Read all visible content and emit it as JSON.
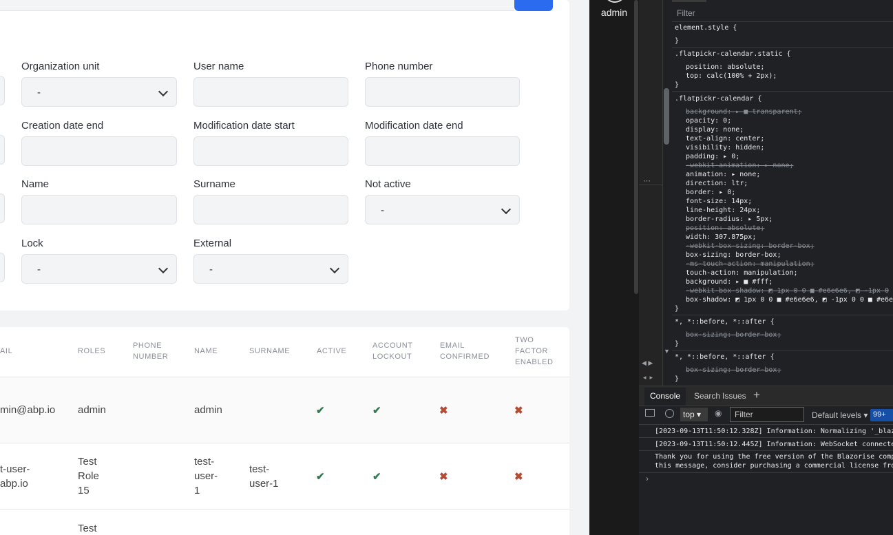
{
  "filters": {
    "org_unit": {
      "label": "Organization unit",
      "value": "-"
    },
    "user_name": {
      "label": "User name",
      "value": ""
    },
    "phone_number": {
      "label": "Phone number",
      "value": ""
    },
    "creation_date_end": {
      "label": "Creation date end",
      "value": ""
    },
    "modification_date_start": {
      "label": "Modification date start",
      "value": ""
    },
    "modification_date_end": {
      "label": "Modification date end",
      "value": ""
    },
    "name": {
      "label": "Name",
      "value": ""
    },
    "surname": {
      "label": "Surname",
      "value": ""
    },
    "not_active": {
      "label": "Not active",
      "value": "-"
    },
    "lock": {
      "label": "Lock",
      "value": "-"
    },
    "external": {
      "label": "External",
      "value": "-"
    }
  },
  "table": {
    "headers": {
      "email": "AIL",
      "roles": "ROLES",
      "phone_number_1": "PHONE",
      "phone_number_2": "NUMBER",
      "name": "NAME",
      "surname": "SURNAME",
      "active": "ACTIVE",
      "account_lockout_1": "ACCOUNT",
      "account_lockout_2": "LOCKOUT",
      "email_confirmed_1": "EMAIL",
      "email_confirmed_2": "CONFIRMED",
      "two_factor_1": "TWO",
      "two_factor_2": "FACTOR",
      "two_factor_3": "ENABLED"
    },
    "rows": [
      {
        "email": "min@abp.io",
        "roles": "admin",
        "name": "admin",
        "surname": ""
      },
      {
        "email_1": "t-user-",
        "email_2": "abp.io",
        "roles_1": "Test",
        "roles_2": "Role",
        "roles_3": "15",
        "name_1": "test-",
        "name_2": "user-",
        "name_3": "1",
        "surname_1": "test-",
        "surname_2": "user-1"
      },
      {
        "roles_1": "Test"
      }
    ],
    "check_icon": "✔",
    "cross_icon": "✖"
  },
  "user_menu": {
    "name": "admin"
  },
  "devtools": {
    "styles_filter": "Filter",
    "rules": [
      {
        "selector": "element.style {",
        "close": "}"
      },
      {
        "selector": ".flatpickr-calendar.static {",
        "props": [
          "position: absolute;",
          "top: calc(100% + 2px);"
        ],
        "close": "}"
      },
      {
        "selector": ".flatpickr-calendar {",
        "close": "}"
      },
      {
        "selector": "*, *::before, *::after {",
        "props": [
          "box-sizing: border-box;"
        ],
        "close": "}"
      },
      {
        "selector": "*, *::before, *::after {",
        "props": [
          "box-sizing: border-box;"
        ],
        "close": "}"
      }
    ],
    "calendar_props": [
      {
        "t": "background: ▸ ■ transparent;",
        "strike": true
      },
      {
        "t": "opacity: 0;"
      },
      {
        "t": "display: none;"
      },
      {
        "t": "text-align: center;"
      },
      {
        "t": "visibility: hidden;"
      },
      {
        "t": "padding: ▸ 0;"
      },
      {
        "t": "-webkit-animation: ▸ none;",
        "strike": true
      },
      {
        "t": "animation: ▸ none;"
      },
      {
        "t": "direction: ltr;"
      },
      {
        "t": "border: ▸ 0;"
      },
      {
        "t": "font-size: 14px;"
      },
      {
        "t": "line-height: 24px;"
      },
      {
        "t": "border-radius: ▸ 5px;"
      },
      {
        "t": "position: absolute;",
        "strike": true
      },
      {
        "t": "width: 307.875px;"
      },
      {
        "t": "-webkit-box-sizing: border-box;",
        "strike": true
      },
      {
        "t": "box-sizing: border-box;"
      },
      {
        "t": "-ms-touch-action: manipulation;",
        "strike": true
      },
      {
        "t": "touch-action: manipulation;"
      },
      {
        "t": "background: ▸ ■ #fff;"
      },
      {
        "t": "-webkit-box-shadow: ◩ 1px 0 0 ■ #e6e6e6, ◩ -1px 0",
        "strike": true
      },
      {
        "t": "box-shadow: ◩ 1px 0 0 ■ #e6e6e6, ◩ -1px 0 0 ■ #e6e"
      }
    ],
    "console_tabs": {
      "console": "Console",
      "search": "Search",
      "issues": "Issues",
      "add": "+"
    },
    "console_toolbar": {
      "context": "top ▾",
      "filter_placeholder": "Filter",
      "levels": "Default levels ▾",
      "badge": "99+"
    },
    "logs": [
      "[2023-09-13T11:50:12.328Z] Information: Normalizing '_blazo",
      "[2023-09-13T11:50:12.445Z] Information: WebSocket connected",
      "Thank you for using the free version of the Blazorise compo",
      "this message, consider purchasing a commercial license from"
    ],
    "prompt": "›"
  }
}
